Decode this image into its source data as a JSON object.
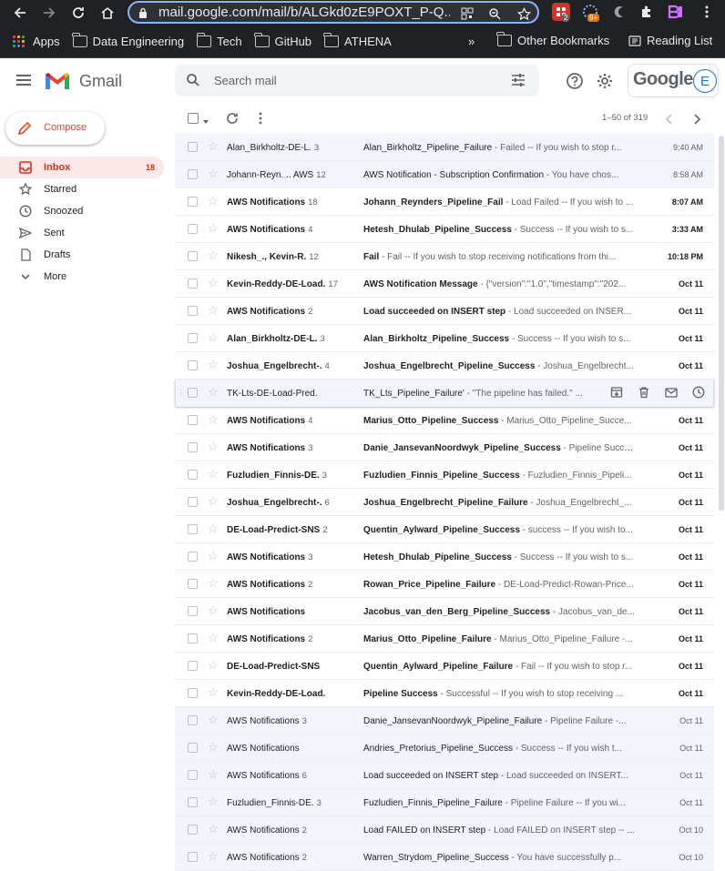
{
  "browser": {
    "url": "mail.google.com/mail/b/ALGkd0zE9POXT_P-Q...",
    "extension_badges": [
      "2",
      "9+"
    ]
  },
  "bookmarks": {
    "apps_label": "Apps",
    "items": [
      "Data Engineering",
      "Tech",
      "GitHub",
      "ATHENA"
    ],
    "overflow": "»",
    "other": "Other Bookmarks",
    "reading_list": "Reading List"
  },
  "gmail": {
    "brand": "Gmail",
    "search_placeholder": "Search mail",
    "account_word": "Google",
    "avatar_letter": "E"
  },
  "sidebar": {
    "compose_label": "Compose",
    "items": [
      {
        "label": "Inbox",
        "count": "18",
        "icon": "inbox-icon",
        "active": true
      },
      {
        "label": "Starred",
        "count": "",
        "icon": "star-icon",
        "active": false
      },
      {
        "label": "Snoozed",
        "count": "",
        "icon": "clock-icon",
        "active": false
      },
      {
        "label": "Sent",
        "count": "",
        "icon": "send-icon",
        "active": false
      },
      {
        "label": "Drafts",
        "count": "",
        "icon": "draft-icon",
        "active": false
      },
      {
        "label": "More",
        "count": "",
        "icon": "chevron-down-icon",
        "active": false
      }
    ]
  },
  "toolbar": {
    "pager": "1–50 of 319"
  },
  "messages": [
    {
      "sender": "Alan_Birkholtz-DE-L.",
      "count": "3",
      "subject": "Alan_Birkholtz_Pipeline_Failure",
      "snippet": " - Failed -- If you wish to stop r...",
      "date": "9:40 AM",
      "unread": false
    },
    {
      "sender": "Johann-Reyn. .. AWS",
      "count": "12",
      "subject": "AWS Notification - Subscription Confirmation",
      "snippet": " - You have chos...",
      "date": "8:58 AM",
      "unread": false
    },
    {
      "sender": "AWS Notifications",
      "count": "18",
      "subject": "Johann_Reynders_Pipeline_Fail",
      "snippet": " - Load Failed -- If you wish to ...",
      "date": "8:07 AM",
      "unread": true
    },
    {
      "sender": "AWS Notifications",
      "count": "4",
      "subject": "Hetesh_Dhulab_Pipeline_Success",
      "snippet": " - Success -- If you wish to s...",
      "date": "3:33 AM",
      "unread": true
    },
    {
      "sender": "Nikesh_., Kevin-R.",
      "count": "12",
      "subject": "Fail",
      "snippet": " - Fail -- If you wish to stop receiving notifications from thi...",
      "date": "10:18 PM",
      "unread": true
    },
    {
      "sender": "Kevin-Reddy-DE-Load.",
      "count": "17",
      "subject": "AWS Notification Message",
      "snippet": " - {\"version\":\"1.0\",\"timestamp\":\"202...",
      "date": "Oct 11",
      "unread": true
    },
    {
      "sender": "AWS Notifications",
      "count": "2",
      "subject": "Load succeeded on INSERT step",
      "snippet": " - Load succeeded on INSER...",
      "date": "Oct 11",
      "unread": true
    },
    {
      "sender": "Alan_Birkholtz-DE-L.",
      "count": "3",
      "subject": "Alan_Birkholtz_Pipeline_Success",
      "snippet": " - Success -- If you wish to s...",
      "date": "Oct 11",
      "unread": true
    },
    {
      "sender": "Joshua_Engelbrecht-.",
      "count": "4",
      "subject": "Joshua_Engelbrecht_Pipeline_Success",
      "snippet": " - Joshua_Engelbrecht...",
      "date": "Oct 11",
      "unread": true
    },
    {
      "sender": "TK-Lts-DE-Load-Pred.",
      "count": "",
      "subject": "TK_Lts_Pipeline_Failure'",
      "snippet": " - \"The pipeline has failed.\" ...",
      "date": "",
      "unread": false,
      "hover": true
    },
    {
      "sender": "AWS Notifications",
      "count": "4",
      "subject": "Marius_Otto_Pipeline_Success",
      "snippet": " - Marius_Otto_Pipeline_Succe...",
      "date": "Oct 11",
      "unread": true
    },
    {
      "sender": "AWS Notifications",
      "count": "3",
      "subject": "Danie_JansevanNoordwyk_Pipeline_Success",
      "snippet": " - Pipeline Succe...",
      "date": "Oct 11",
      "unread": true
    },
    {
      "sender": "Fuzludien_Finnis-DE.",
      "count": "3",
      "subject": "Fuzludien_Finnis_Pipeline_Success",
      "snippet": " - Fuzludien_Finnis_Pipeli...",
      "date": "Oct 11",
      "unread": true
    },
    {
      "sender": "Joshua_Engelbrecht-.",
      "count": "6",
      "subject": "Joshua_Engelbrecht_Pipeline_Failure",
      "snippet": " - Joshua_Engelbrecht_...",
      "date": "Oct 11",
      "unread": true
    },
    {
      "sender": "DE-Load-Predict-SNS",
      "count": "2",
      "subject": "Quentin_Aylward_Pipeline_Success",
      "snippet": " - success -- If you wish to...",
      "date": "Oct 11",
      "unread": true
    },
    {
      "sender": "AWS Notifications",
      "count": "3",
      "subject": "Hetesh_Dhulab_Pipeline_Success",
      "snippet": " - Success -- If you wish to s...",
      "date": "Oct 11",
      "unread": true
    },
    {
      "sender": "AWS Notifications",
      "count": "2",
      "subject": "Rowan_Price_Pipeline_Failure",
      "snippet": " - DE-Load-Predict-Rowan-Price...",
      "date": "Oct 11",
      "unread": true
    },
    {
      "sender": "AWS Notifications",
      "count": "",
      "subject": "Jacobus_van_den_Berg_Pipeline_Success",
      "snippet": " - Jacobus_van_de...",
      "date": "Oct 11",
      "unread": true
    },
    {
      "sender": "AWS Notifications",
      "count": "2",
      "subject": "Marius_Otto_Pipeline_Failure",
      "snippet": " - Marius_Otto_Pipeline_Failure -...",
      "date": "Oct 11",
      "unread": true
    },
    {
      "sender": "DE-Load-Predict-SNS",
      "count": "",
      "subject": "Quentin_Aylward_Pipeline_Failure",
      "snippet": " - Fail -- If you wish to stop r...",
      "date": "Oct 11",
      "unread": true
    },
    {
      "sender": "Kevin-Reddy-DE-Load.",
      "count": "",
      "subject": "Pipeline Success",
      "snippet": " - Successful -- If you wish to stop receiving ...",
      "date": "Oct 11",
      "unread": true
    },
    {
      "sender": "AWS Notifications",
      "count": "3",
      "subject": "Danie_JansevanNoordwyk_Pipeline_Failure",
      "snippet": " - Pipeline Failure -...",
      "date": "Oct 11",
      "unread": false
    },
    {
      "sender": "AWS Notifications",
      "count": "",
      "subject": "Andries_Pretorius_Pipeline_Success",
      "snippet": " - Success -- If you wish t...",
      "date": "Oct 11",
      "unread": false
    },
    {
      "sender": "AWS Notifications",
      "count": "6",
      "subject": "Load succeeded on INSERT step",
      "snippet": " - Load succeeded on INSERT...",
      "date": "Oct 11",
      "unread": false
    },
    {
      "sender": "Fuzludien_Finnis-DE.",
      "count": "3",
      "subject": "Fuzludien_Finnis_Pipeline_Failure",
      "snippet": " - Pipeline Failure -- If you wi...",
      "date": "Oct 11",
      "unread": false
    },
    {
      "sender": "AWS Notifications",
      "count": "2",
      "subject": "Load FAILED on INSERT step",
      "snippet": " - Load FAILED on INSERT step -- ...",
      "date": "Oct 10",
      "unread": false
    },
    {
      "sender": "AWS Notifications",
      "count": "2",
      "subject": "Warren_Strydom_Pipeline_Success",
      "snippet": " - You have successfully p...",
      "date": "Oct 10",
      "unread": false
    }
  ]
}
